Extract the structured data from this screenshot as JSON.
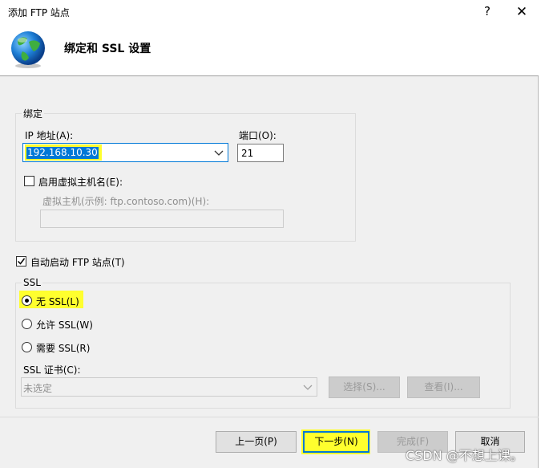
{
  "window": {
    "title": "添加 FTP 站点",
    "help": "?",
    "close": "✕"
  },
  "header": {
    "title": "绑定和 SSL 设置"
  },
  "binding": {
    "group_label": "绑定",
    "ip_label": "IP 地址(A):",
    "ip_value": "192.168.10.30",
    "port_label": "端口(O):",
    "port_value": "21",
    "vhost_checkbox_label": "启用虚拟主机名(E):",
    "vhost_checked": false,
    "vhost_label": "虚拟主机(示例: ftp.contoso.com)(H):",
    "vhost_value": ""
  },
  "autostart": {
    "label": "自动启动 FTP 站点(T)",
    "checked": true
  },
  "ssl": {
    "group_label": "SSL",
    "options": [
      {
        "label": "无 SSL(L)",
        "selected": true
      },
      {
        "label": "允许 SSL(W)",
        "selected": false
      },
      {
        "label": "需要 SSL(R)",
        "selected": false
      }
    ],
    "cert_label": "SSL 证书(C):",
    "cert_value": "未选定",
    "select_button": "选择(S)...",
    "view_button": "查看(I)..."
  },
  "footer": {
    "prev": "上一页(P)",
    "next": "下一步(N)",
    "finish": "完成(F)",
    "cancel": "取消"
  },
  "watermark": "CSDN @不想上课。",
  "colors": {
    "highlight": "#ffff2e",
    "focus_border": "#0078d7",
    "selection": "#0078d7"
  }
}
